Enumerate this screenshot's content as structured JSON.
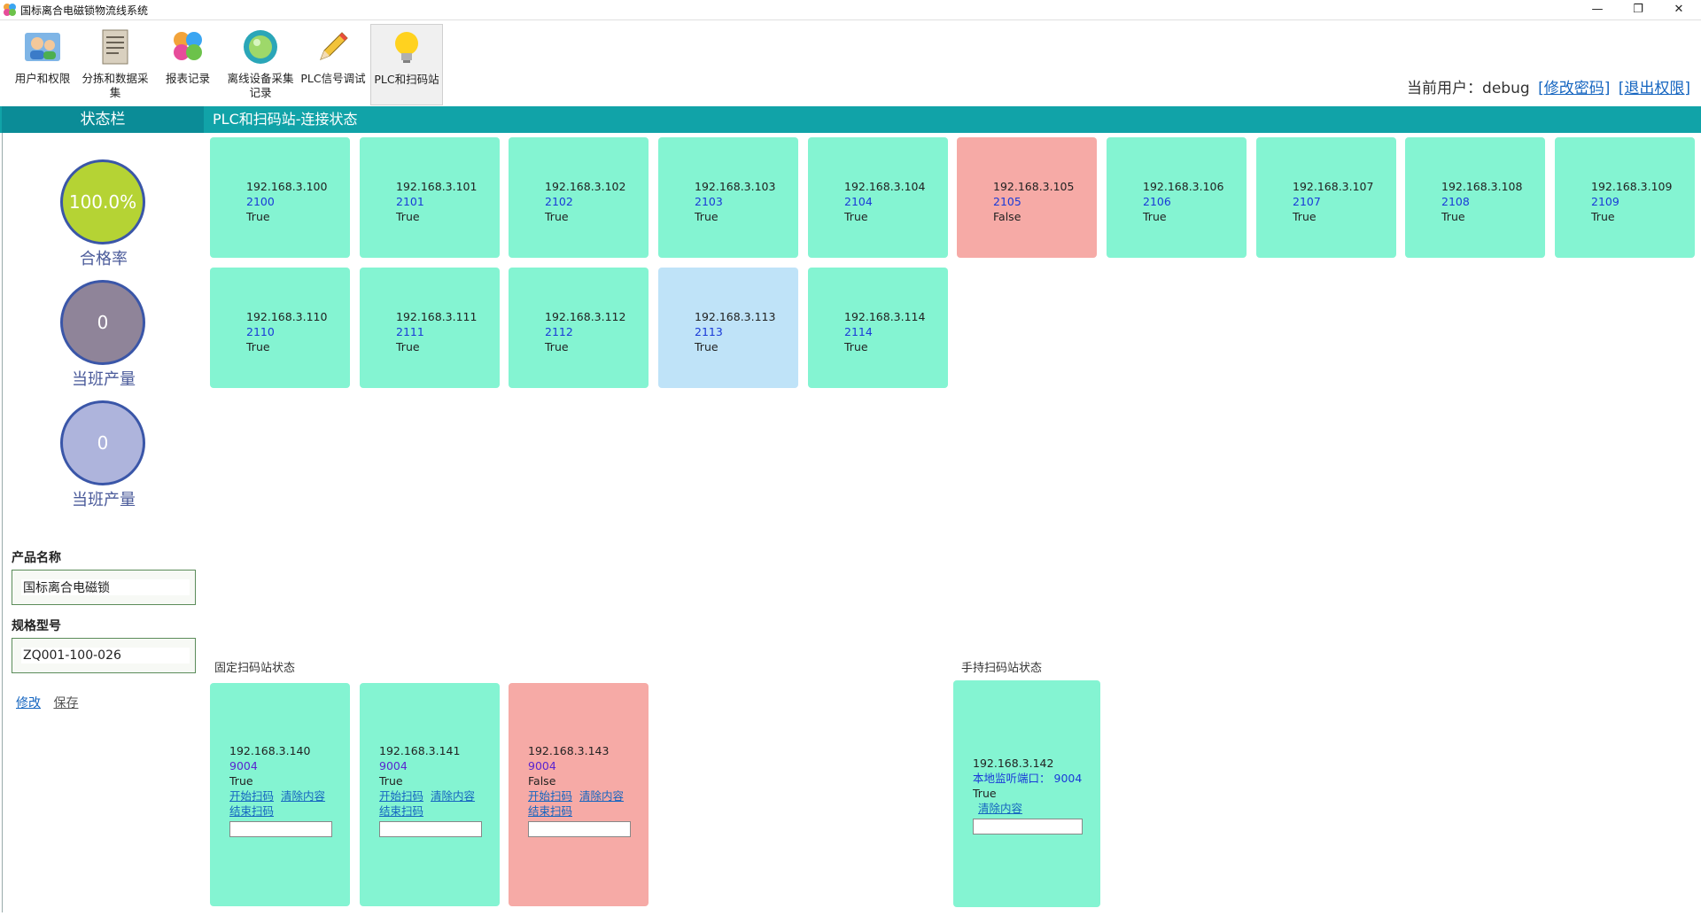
{
  "window": {
    "title": "国标离合电磁锁物流线系统",
    "min": "—",
    "max": "❐",
    "close": "✕"
  },
  "toolbar": {
    "items": [
      {
        "label": "用户和权限"
      },
      {
        "label": "分拣和数据采集"
      },
      {
        "label": "报表记录"
      },
      {
        "label": "离线设备采集记录"
      },
      {
        "label": "PLC信号调试"
      },
      {
        "label": "PLC和扫码站"
      }
    ],
    "user_prefix": "当前用户：",
    "user_name": "debug",
    "change_password": "[修改密码]",
    "logout": "[退出权限]"
  },
  "sidebar": {
    "title": "状态栏",
    "stats": [
      {
        "value": "100.0%",
        "label": "合格率",
        "color": "#b5d334"
      },
      {
        "value": "0",
        "label": "当班产量",
        "color": "#8f8499"
      },
      {
        "value": "0",
        "label": "当班产量",
        "color": "#aeb4dc"
      }
    ],
    "product_name_label": "产品名称",
    "product_name": "国标离合电磁锁",
    "spec_label": "规格型号",
    "spec": "ZQ001-100-026",
    "edit_link": "修改",
    "save_link": "保存"
  },
  "main": {
    "title": "PLC和扫码站-连接状态",
    "plc_stations": [
      {
        "ip": "192.168.3.100",
        "port": "2100",
        "status": "True"
      },
      {
        "ip": "192.168.3.101",
        "port": "2101",
        "status": "True"
      },
      {
        "ip": "192.168.3.102",
        "port": "2102",
        "status": "True"
      },
      {
        "ip": "192.168.3.103",
        "port": "2103",
        "status": "True"
      },
      {
        "ip": "192.168.3.104",
        "port": "2104",
        "status": "True"
      },
      {
        "ip": "192.168.3.105",
        "port": "2105",
        "status": "False"
      },
      {
        "ip": "192.168.3.106",
        "port": "2106",
        "status": "True"
      },
      {
        "ip": "192.168.3.107",
        "port": "2107",
        "status": "True"
      },
      {
        "ip": "192.168.3.108",
        "port": "2108",
        "status": "True"
      },
      {
        "ip": "192.168.3.109",
        "port": "2109",
        "status": "True"
      },
      {
        "ip": "192.168.3.110",
        "port": "2110",
        "status": "True"
      },
      {
        "ip": "192.168.3.111",
        "port": "2111",
        "status": "True"
      },
      {
        "ip": "192.168.3.112",
        "port": "2112",
        "status": "True"
      },
      {
        "ip": "192.168.3.113",
        "port": "2113",
        "status": "True"
      },
      {
        "ip": "192.168.3.114",
        "port": "2114",
        "status": "True"
      }
    ],
    "fixed_scan_label": "固定扫码站状态",
    "fixed_scanners": [
      {
        "ip": "192.168.3.140",
        "port": "9004",
        "status": "True"
      },
      {
        "ip": "192.168.3.141",
        "port": "9004",
        "status": "True"
      },
      {
        "ip": "192.168.3.143",
        "port": "9004",
        "status": "False"
      }
    ],
    "start_scan": "开始扫码",
    "clear_content": "清除内容",
    "end_scan": "结束扫码",
    "handheld_label": "手持扫码站状态",
    "handheld": {
      "ip": "192.168.3.142",
      "port_label": "本地监听端口：",
      "port": "9004",
      "status": "True",
      "clear": "清除内容"
    }
  }
}
